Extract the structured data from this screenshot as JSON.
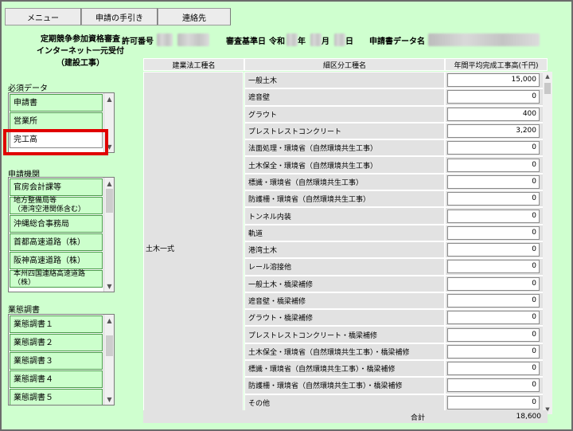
{
  "menu": [
    "メニュー",
    "申請の手引き",
    "連絡先"
  ],
  "header": {
    "title_lines": [
      "定期競争参加資格審査",
      "インターネット一元受付",
      "（建設工事）"
    ],
    "permit_label": "許可番号",
    "audit_label": "審査基準日",
    "era_label": "令和",
    "year_suffix": "年",
    "month_suffix": "月",
    "day_suffix": "日",
    "datafile_label": "申請書データ名"
  },
  "left": {
    "required_label": "必須データ",
    "required_items": [
      "申請書",
      "営業所",
      "完工高"
    ],
    "selected_index": 2,
    "agency_label": "申請機関",
    "agency_items": [
      "官房会計課等",
      "地方整備局等\n（港湾空港関係含む）",
      "沖縄総合事務局",
      "首都高速道路（株）",
      "阪神高速道路（株）",
      "本州四国連絡高速道路\n（株）"
    ],
    "survey_label": "業態調書",
    "survey_items": [
      "業態調書１",
      "業態調書２",
      "業態調書３",
      "業態調書４",
      "業態調書５"
    ]
  },
  "table": {
    "headers": [
      "建業法工種名",
      "細区分工種名",
      "年間平均完成工事高(千円)"
    ],
    "category": "土木一式",
    "rows": [
      {
        "name": "一般土木",
        "value": "15,000"
      },
      {
        "name": "遮音壁",
        "value": "0"
      },
      {
        "name": "グラウト",
        "value": "400"
      },
      {
        "name": "プレストレストコンクリート",
        "value": "3,200"
      },
      {
        "name": "法面処理・環境省（自然環境共生工事）",
        "value": "0"
      },
      {
        "name": "土木保全・環境省（自然環境共生工事）",
        "value": "0"
      },
      {
        "name": "標識・環境省（自然環境共生工事）",
        "value": "0"
      },
      {
        "name": "防護柵・環境省（自然環境共生工事）",
        "value": "0"
      },
      {
        "name": "トンネル内装",
        "value": "0"
      },
      {
        "name": "軌道",
        "value": "0"
      },
      {
        "name": "港湾土木",
        "value": "0"
      },
      {
        "name": "レール溶接他",
        "value": "0"
      },
      {
        "name": "一般土木・橋梁補修",
        "value": "0"
      },
      {
        "name": "遮音壁・橋梁補修",
        "value": "0"
      },
      {
        "name": "グラウト・橋梁補修",
        "value": "0"
      },
      {
        "name": "プレストレストコンクリート・橋梁補修",
        "value": "0"
      },
      {
        "name": "土木保全・環境省（自然環境共生工事）・橋梁補修",
        "value": "0"
      },
      {
        "name": "標識・環境省（自然環境共生工事）・橋梁補修",
        "value": "0"
      },
      {
        "name": "防護柵・環境省（自然環境共生工事）・橋梁補修",
        "value": "0"
      },
      {
        "name": "その他",
        "value": "0"
      }
    ],
    "total_label": "合計",
    "total_value": "18,600"
  }
}
